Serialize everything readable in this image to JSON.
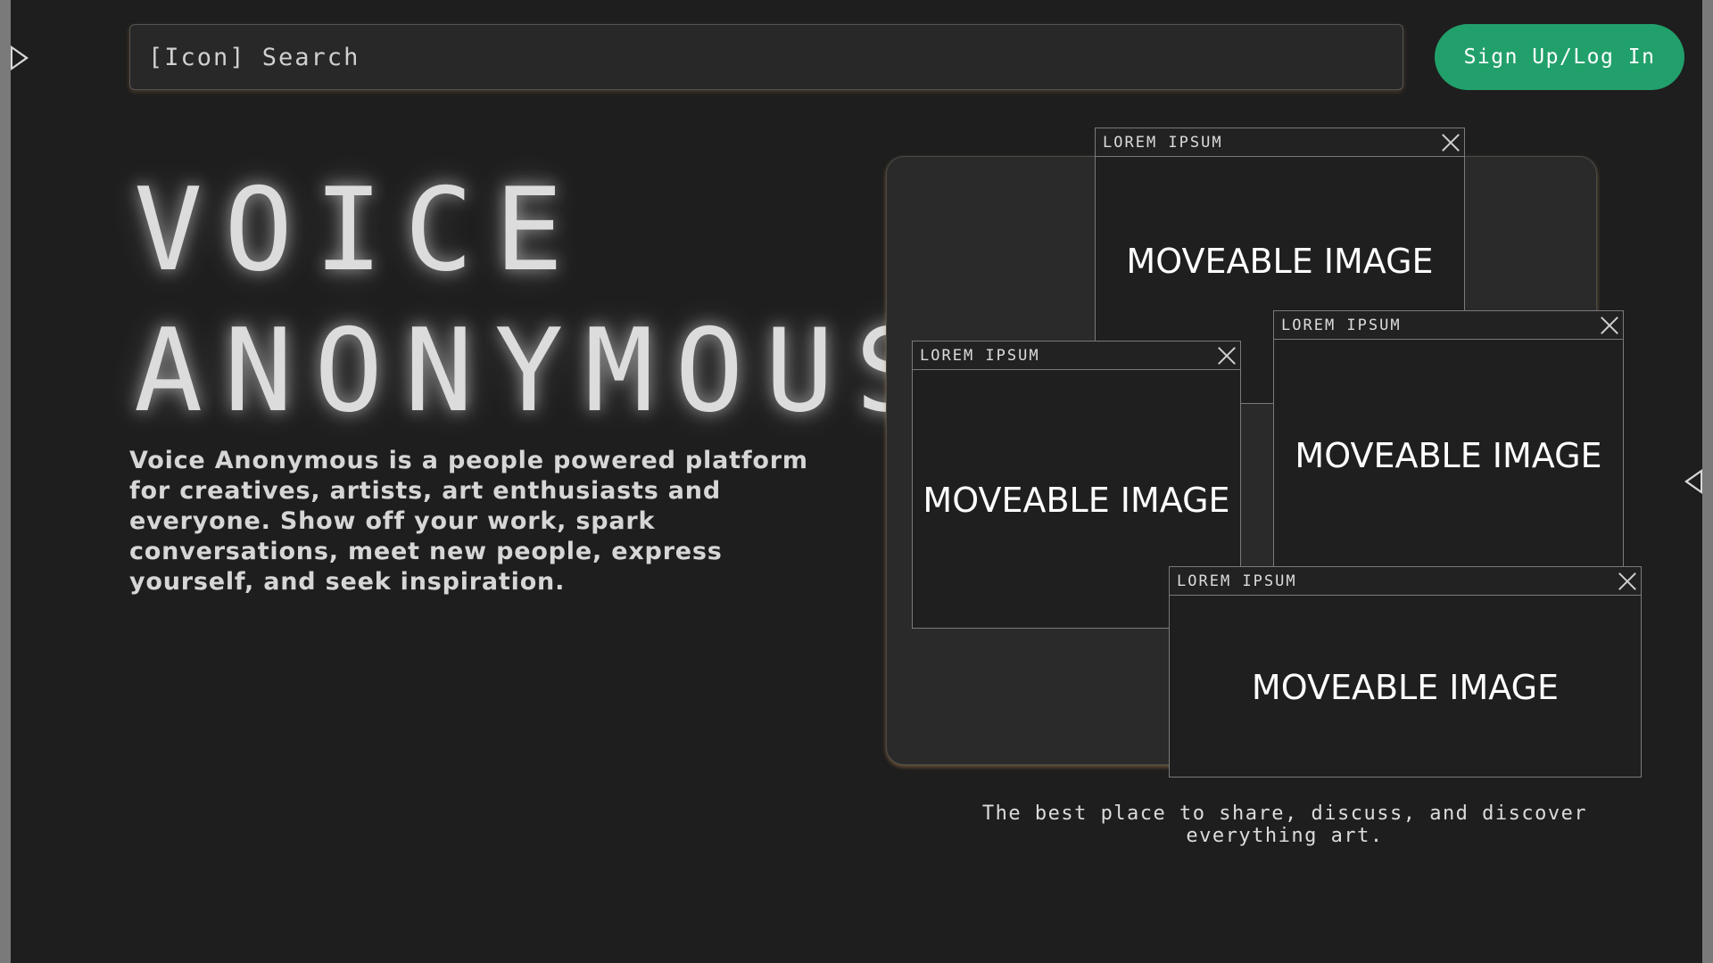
{
  "search": {
    "text": "[Icon] Search"
  },
  "header": {
    "signup_label": "Sign Up/Log In"
  },
  "hero": {
    "title_line1": "VOICE",
    "title_line2": "ANONYMOUS",
    "description": "Voice Anonymous is a people powered platform for creatives, artists, art enthusiasts and everyone. Show off your work, spark conversations, meet new people, express yourself, and seek inspiration."
  },
  "gallery": {
    "windows": [
      {
        "title": "LOREM IPSUM",
        "body": "MOVEABLE IMAGE"
      },
      {
        "title": "LOREM IPSUM",
        "body": "MOVEABLE IMAGE"
      },
      {
        "title": "LOREM IPSUM",
        "body": "MOVEABLE IMAGE"
      },
      {
        "title": "LOREM IPSUM",
        "body": "MOVEABLE IMAGE"
      }
    ],
    "tagline": "The best place to share, discuss, and discover everything art."
  },
  "colors": {
    "background": "#1e1e1e",
    "accent": "#22a06b",
    "panel": "#2a2a2a"
  },
  "icons": {
    "left_toggle": "play-triangle-right-icon",
    "right_toggle": "play-triangle-left-icon",
    "window_close": "close-x-icon"
  }
}
